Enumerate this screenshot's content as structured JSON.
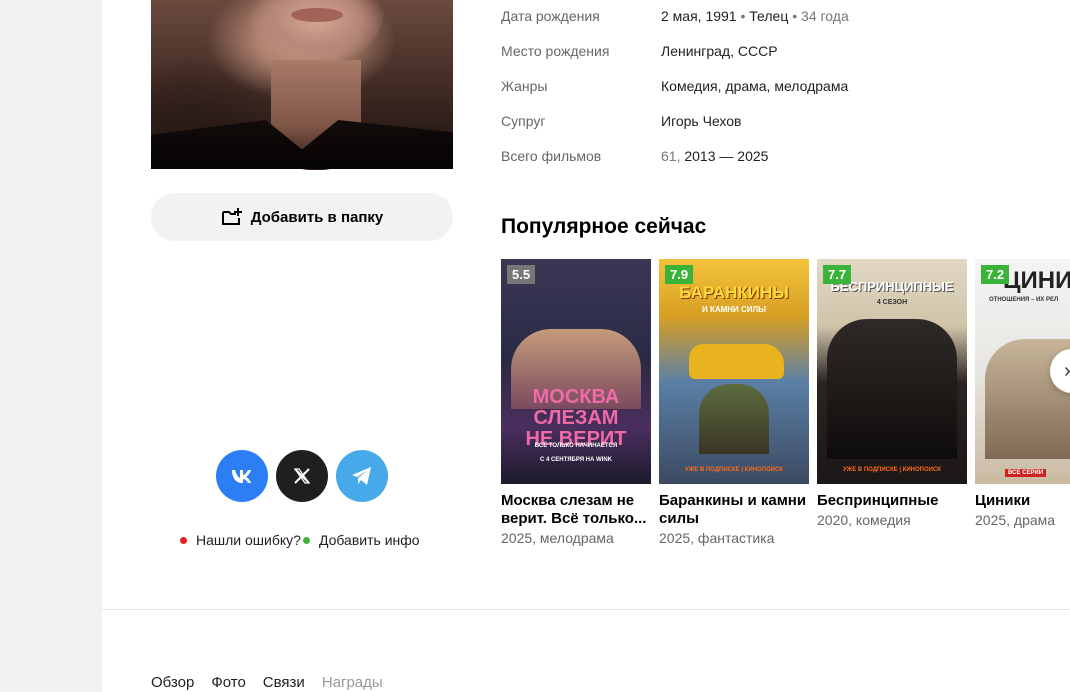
{
  "left": {
    "add_folder_label": "Добавить в папку",
    "report_error": "Нашли ошибку?",
    "add_info": "Добавить инфо"
  },
  "info_rows": [
    {
      "key": "Дата рождения",
      "value": "2 мая, 1991",
      "sep1": " • ",
      "extra": "Телец",
      "sep2": " • ",
      "muted": "34 года"
    },
    {
      "key": "Место рождения",
      "value": "Ленинград, СССР"
    },
    {
      "key": "Жанры",
      "value": "Комедия, драма, мелодрама"
    },
    {
      "key": "Супруг",
      "value": "Игорь Чехов"
    },
    {
      "key": "Всего фильмов",
      "muted": "61, ",
      "value": "2013 — 2025"
    }
  ],
  "popular": {
    "title": "Популярное сейчас",
    "cards": [
      {
        "rating": "5.5",
        "title": "Москва слезам не верит. Всё только...",
        "sub": "2025, мелодрама",
        "poster_text": "МОСКВА СЛЕЗАМ НЕ ВЕРИТ",
        "poster_small": "ВСЁ ТОЛЬКО НАЧИНАЕТСЯ",
        "poster_date": "С 4 СЕНТЯБРЯ НА WINK"
      },
      {
        "rating": "7.9",
        "title": "Баранкины и камни силы",
        "sub": "2025, фантастика",
        "poster_text": "БАРАНКИНЫ",
        "poster_small": "И КАМНИ СИЛЫ",
        "poster_date": "УЖЕ В ПОДПИСКЕ | КИНОПОИСК"
      },
      {
        "rating": "7.7",
        "title": "Беспринципные",
        "sub": "2020, комедия",
        "poster_text": "БЕСПРИНЦИПНЫЕ",
        "poster_small": "4 СЕЗОН",
        "poster_date": "УЖЕ В ПОДПИСКЕ | КИНОПОИСК"
      },
      {
        "rating": "7.2",
        "title": "Циники",
        "sub": "2025, драма",
        "poster_text": "ЦИНИ",
        "poster_small": "ОТНОШЕНИЯ – ИХ РЕЛ",
        "poster_date": "ВСЕ СЕРИИ"
      }
    ]
  },
  "tabs": [
    "Обзор",
    "Фото",
    "Связи",
    "Награды"
  ],
  "icons": {
    "next": "›",
    "vk": "VK",
    "x": "𝕏"
  }
}
